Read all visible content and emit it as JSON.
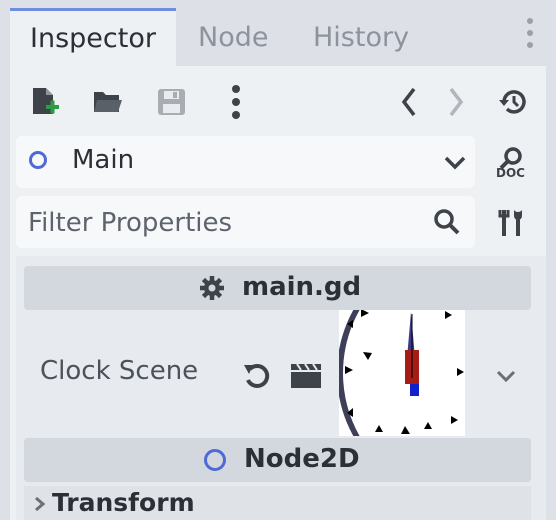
{
  "tabs": [
    {
      "label": "Inspector",
      "active": true
    },
    {
      "label": "Node",
      "active": false
    },
    {
      "label": "History",
      "active": false
    }
  ],
  "toolbar": {
    "icons": [
      "new-resource-icon",
      "open-folder-icon",
      "save-icon",
      "more-vert-icon",
      "back-arrow-icon",
      "forward-arrow-icon",
      "history-icon"
    ]
  },
  "object_selector": {
    "value": "Main",
    "icon": "node-circle-icon"
  },
  "doc_button": {
    "label": "DOC"
  },
  "filter": {
    "placeholder": "Filter Properties"
  },
  "script_section": {
    "title": "main.gd",
    "icon": "gear-icon"
  },
  "property": {
    "label": "Clock Scene",
    "value_icon": "clock-scene-thumbnail"
  },
  "node_section": {
    "title": "Node2D",
    "icon": "node-circle-icon"
  },
  "transform": {
    "label": "Transform",
    "expanded": false
  },
  "colors": {
    "accent": "#4f6ad6",
    "tab_underline": "#6f8ddc",
    "background": "#dde1e7"
  }
}
